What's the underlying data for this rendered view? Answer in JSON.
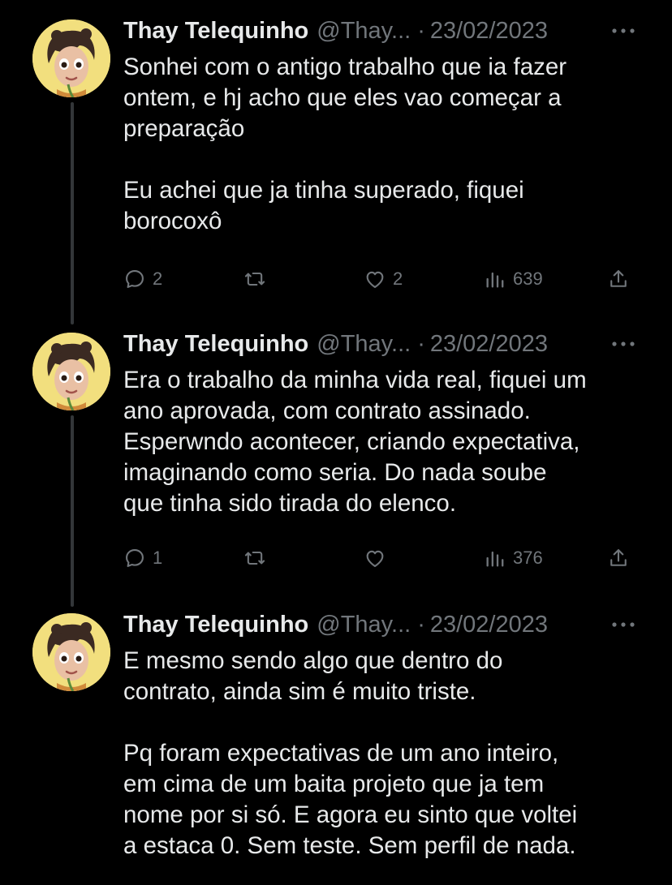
{
  "tweets": [
    {
      "name": "Thay Telequinho",
      "handle": "@Thay...",
      "separator": "·",
      "date": "23/02/2023",
      "text": "Sonhei com o antigo trabalho que ia fazer\nontem, e hj acho que eles vao começar a\npreparação\n\nEu achei que ja tinha superado, fiquei\nborocoxô",
      "replies": "2",
      "retweets": "",
      "likes": "2",
      "views": "639"
    },
    {
      "name": "Thay Telequinho",
      "handle": "@Thay...",
      "separator": "·",
      "date": "23/02/2023",
      "text": "Era o trabalho da minha vida real, fiquei um\nano aprovada, com contrato assinado.\nEsperwndo acontecer, criando expectativa,\nimaginando como seria. Do nada soube\nque tinha sido tirada do elenco.",
      "replies": "1",
      "retweets": "",
      "likes": "",
      "views": "376"
    },
    {
      "name": "Thay Telequinho",
      "handle": "@Thay...",
      "separator": "·",
      "date": "23/02/2023",
      "text": "E mesmo sendo algo que dentro do\ncontrato, ainda sim é muito triste.\n\nPq foram expectativas de um ano inteiro,\nem cima de um baita projeto que ja tem\nnome por si só. E agora eu sinto que voltei\na estaca 0. Sem teste. Sem perfil de nada."
    }
  ],
  "icons": {
    "reply": "reply-icon",
    "retweet": "retweet-icon",
    "like": "heart-icon",
    "views": "views-icon",
    "share": "share-icon",
    "more": "more-icon"
  },
  "colors": {
    "background": "#000000",
    "text": "#e7e9ea",
    "secondary": "#71767b",
    "thread_line": "#333639",
    "avatar_bg": "#f2df7e"
  }
}
